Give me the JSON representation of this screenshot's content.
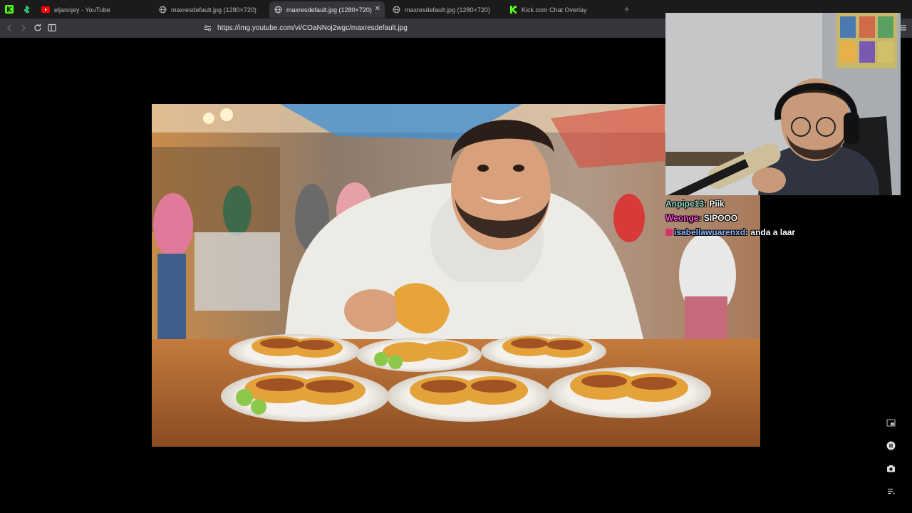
{
  "tabs": [
    {
      "title": "eljanojey - YouTube",
      "icon": "youtube-icon",
      "active": false
    },
    {
      "title": "maxresdefault.jpg (1280×720)",
      "icon": "globe-icon",
      "active": false
    },
    {
      "title": "maxresdefault.jpg (1280×720)",
      "icon": "globe-icon",
      "active": true
    },
    {
      "title": "maxresdefault.jpg (1280×720)",
      "icon": "globe-icon",
      "active": false
    },
    {
      "title": "Kick.com Chat Overlay",
      "icon": "kick-icon",
      "active": false
    }
  ],
  "address_bar": {
    "url": "https://img.youtube.com/vi/COaNNoj2wgc/maxresdefault.jpg"
  },
  "chat": {
    "messages": [
      {
        "user": "Anpipe13",
        "text": "Piik",
        "color": "#8fe3d0",
        "badge": false
      },
      {
        "user": "Weonge",
        "text": "SIPOOO",
        "color": "#ff4fd8",
        "badge": false
      },
      {
        "user": "isabellawuarenxd",
        "text": "anda a laar",
        "color": "#8fb8ff",
        "badge": true
      }
    ]
  },
  "colors": {
    "tabstrip_bg": "#1b1b1c",
    "toolbar_bg": "#35363a",
    "kick_green": "#53fc18",
    "youtube_red": "#ff0000"
  }
}
